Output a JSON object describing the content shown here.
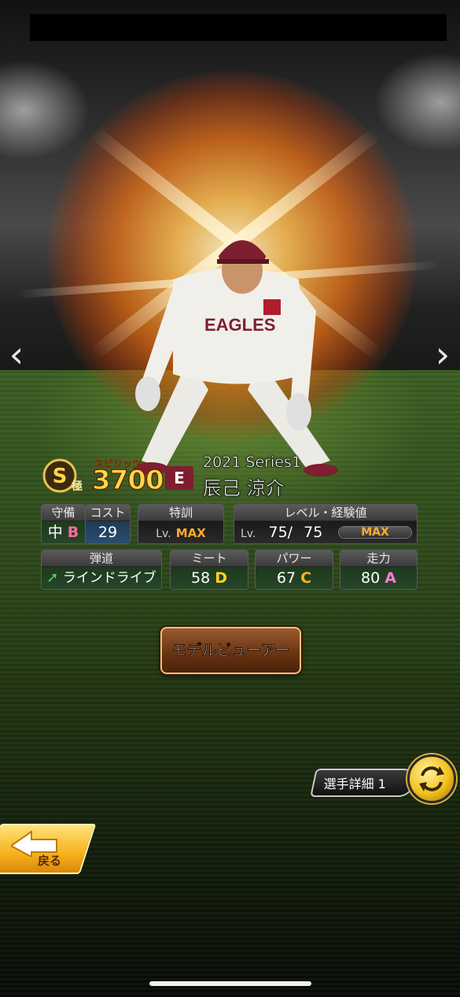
{
  "player": {
    "rank_badge": "S",
    "rank_kanji": "極",
    "spirits_label": "スピリッツ",
    "spirits_value": "3700",
    "team_logo_text": "E",
    "series": "2021 Series1",
    "name": "辰己 涼介"
  },
  "stats_row1": {
    "position_header": "守備",
    "position_value": "中",
    "position_grade": "B",
    "cost_header": "コスト",
    "cost_value": "29",
    "training_header": "特訓",
    "training_lv": "Lv.",
    "training_value": "MAX",
    "level_header": "レベル・経験値",
    "level_lv": "Lv.",
    "level_current": "75/",
    "level_max": "75",
    "exp_bar_label": "MAX",
    "exp_fill": 1.0
  },
  "stats_row2": {
    "trajectory_header": "弾道",
    "trajectory_value": "ラインドライブ",
    "contact_header": "ミート",
    "contact_value": "58",
    "contact_grade": "D",
    "power_header": "パワー",
    "power_value": "67",
    "power_grade": "C",
    "speed_header": "走力",
    "speed_value": "80",
    "speed_grade": "A"
  },
  "buttons": {
    "model_viewer": "モデルビューアー",
    "player_detail": "選手詳細 1",
    "back": "戻る"
  },
  "colors": {
    "team": "#7d1f2f",
    "grade_b": "#ff6a9a",
    "grade_a": "#ff7ad0",
    "grade_c": "#ffb21a",
    "grade_d": "#ffd21a",
    "max": "#ffab2d"
  }
}
